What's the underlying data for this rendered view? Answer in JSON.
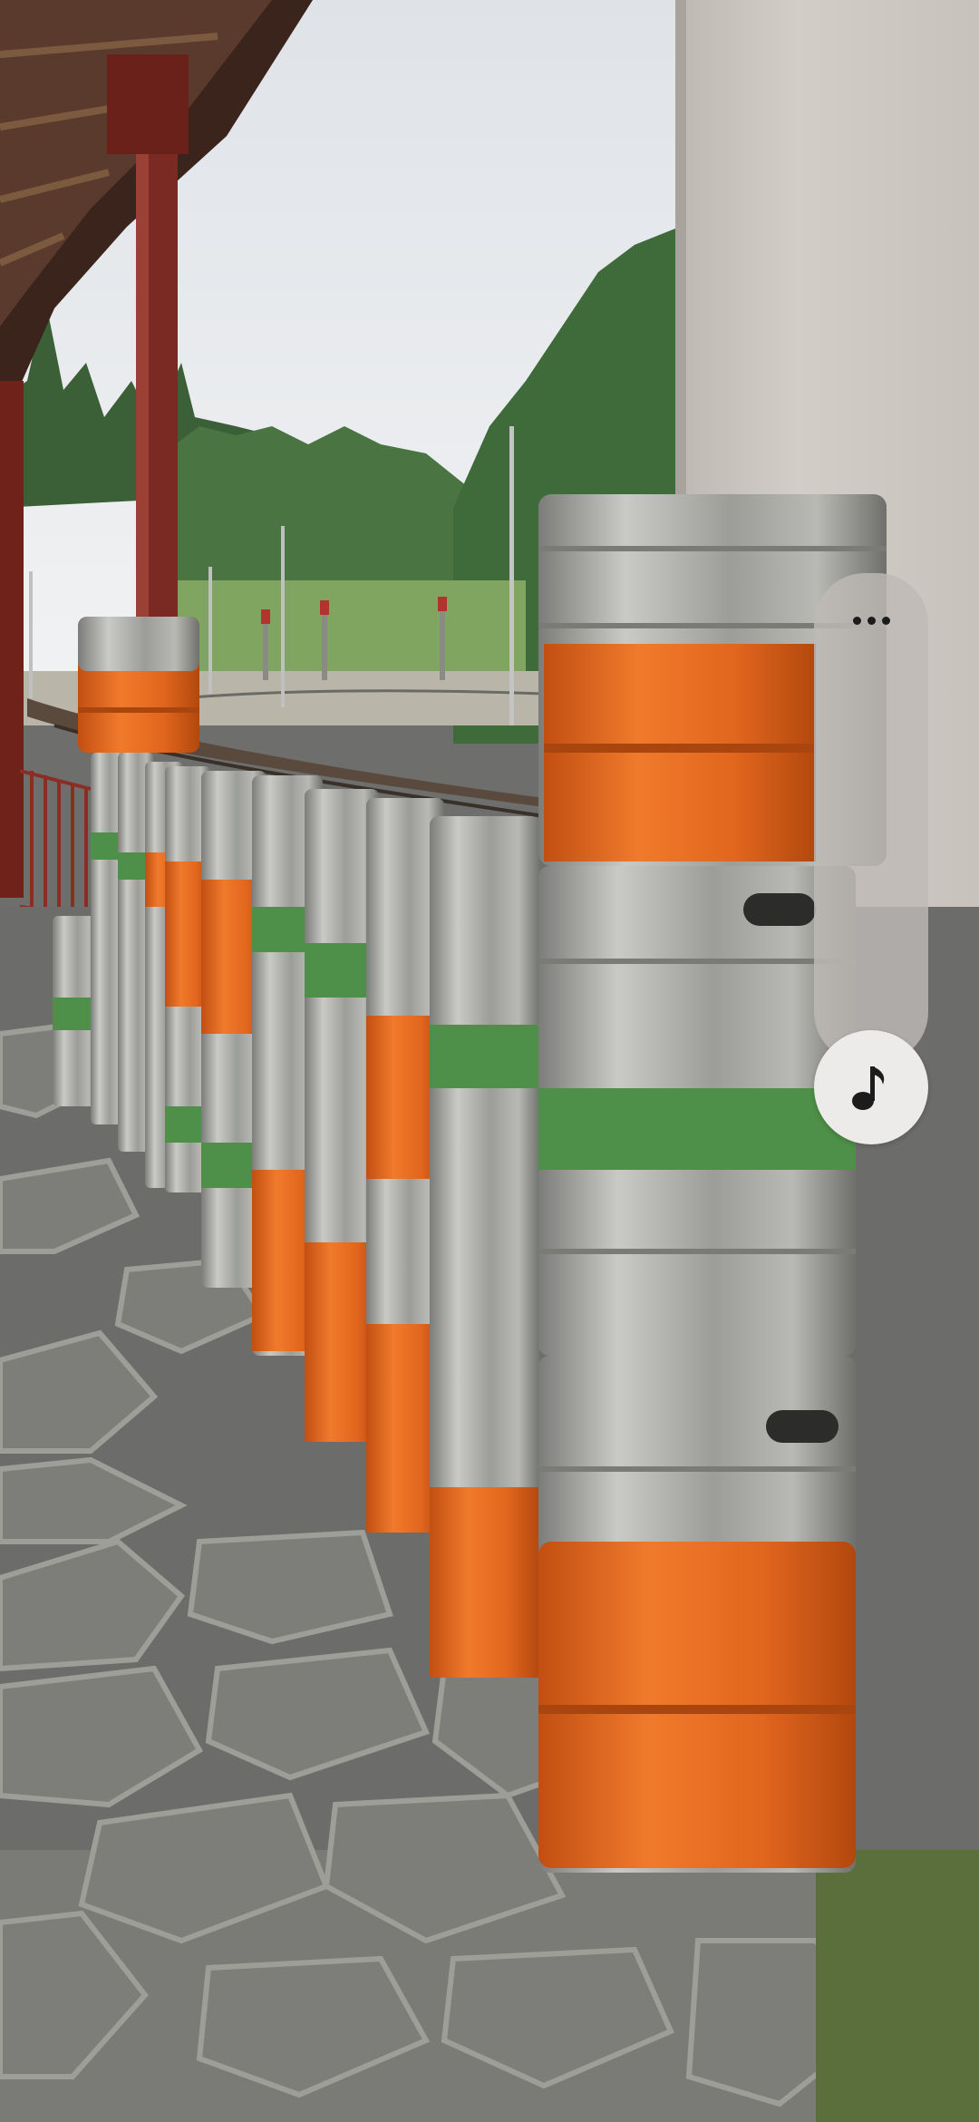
{
  "photo": {
    "description_icon": "photo-of-beer-kegs"
  },
  "side_panel": {
    "more_icon": "more-horizontal-icon",
    "music_icon": "music-note-icon"
  },
  "colors": {
    "panel": "#bebab6",
    "music_button": "#ecebea",
    "icon": "#1c1c1c",
    "keg_orange": "#e0661e",
    "keg_steel": "#a8a8a4",
    "keg_green": "#4e9a4c",
    "wall": "#cfcac3",
    "pavement": "#6e6e6c",
    "sky": "#e8ebee",
    "trees": "#3f6a3a",
    "column": "#7a2a22"
  }
}
